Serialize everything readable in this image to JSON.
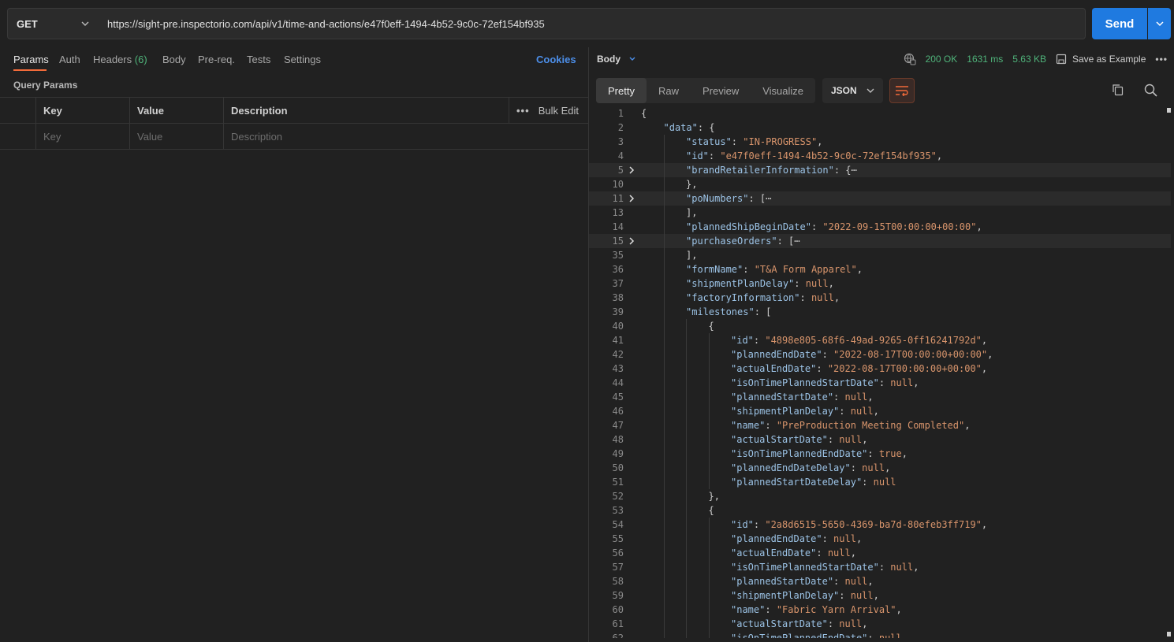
{
  "request": {
    "method": "GET",
    "url": "https://sight-pre.inspectorio.com/api/v1/time-and-actions/e47f0eff-1494-4b52-9c0c-72ef154bf935",
    "send_label": "Send"
  },
  "left_tabs": {
    "params": "Params",
    "auth": "Auth",
    "headers": "Headers",
    "headers_count": "(6)",
    "body": "Body",
    "prereq": "Pre-req.",
    "tests": "Tests",
    "settings": "Settings",
    "cookies": "Cookies"
  },
  "query_params": {
    "title": "Query Params",
    "columns": [
      "Key",
      "Value",
      "Description"
    ],
    "bulk_edit": "Bulk Edit",
    "placeholders": [
      "Key",
      "Value",
      "Description"
    ]
  },
  "response": {
    "section": "Body",
    "status": "200 OK",
    "time": "1631 ms",
    "size": "5.63 KB",
    "save_example": "Save as Example",
    "modes": [
      "Pretty",
      "Raw",
      "Preview",
      "Visualize"
    ],
    "format": "JSON",
    "colors": {
      "accent": "#1f7ae0",
      "ok": "#4fb37a",
      "tab_underline": "#f26b3a",
      "key": "#9cc3e6",
      "string": "#d9956c"
    }
  },
  "code_lines": [
    {
      "n": "1",
      "indent": 0,
      "parts": [
        [
          "p",
          "{"
        ]
      ]
    },
    {
      "n": "2",
      "indent": 1,
      "parts": [
        [
          "k",
          "\"data\""
        ],
        [
          "p",
          ": {"
        ]
      ]
    },
    {
      "n": "3",
      "indent": 2,
      "parts": [
        [
          "k",
          "\"status\""
        ],
        [
          "p",
          ": "
        ],
        [
          "s",
          "\"IN-PROGRESS\""
        ],
        [
          "p",
          ","
        ]
      ]
    },
    {
      "n": "4",
      "indent": 2,
      "parts": [
        [
          "k",
          "\"id\""
        ],
        [
          "p",
          ": "
        ],
        [
          "s",
          "\"e47f0eff-1494-4b52-9c0c-72ef154bf935\""
        ],
        [
          "p",
          ","
        ]
      ]
    },
    {
      "n": "5",
      "indent": 2,
      "fold": true,
      "hl": true,
      "parts": [
        [
          "k",
          "\"brandRetailerInformation\""
        ],
        [
          "p",
          ": {⋯"
        ]
      ]
    },
    {
      "n": "10",
      "indent": 2,
      "parts": [
        [
          "p",
          "},"
        ]
      ]
    },
    {
      "n": "11",
      "indent": 2,
      "fold": true,
      "hl": true,
      "parts": [
        [
          "k",
          "\"poNumbers\""
        ],
        [
          "p",
          ": [⋯"
        ]
      ]
    },
    {
      "n": "13",
      "indent": 2,
      "parts": [
        [
          "p",
          "],"
        ]
      ]
    },
    {
      "n": "14",
      "indent": 2,
      "parts": [
        [
          "k",
          "\"plannedShipBeginDate\""
        ],
        [
          "p",
          ": "
        ],
        [
          "s",
          "\"2022-09-15T00:00:00+00:00\""
        ],
        [
          "p",
          ","
        ]
      ]
    },
    {
      "n": "15",
      "indent": 2,
      "fold": true,
      "hl": true,
      "parts": [
        [
          "k",
          "\"purchaseOrders\""
        ],
        [
          "p",
          ": [⋯"
        ]
      ]
    },
    {
      "n": "35",
      "indent": 2,
      "parts": [
        [
          "p",
          "],"
        ]
      ]
    },
    {
      "n": "36",
      "indent": 2,
      "parts": [
        [
          "k",
          "\"formName\""
        ],
        [
          "p",
          ": "
        ],
        [
          "s",
          "\"T&A Form Apparel\""
        ],
        [
          "p",
          ","
        ]
      ]
    },
    {
      "n": "37",
      "indent": 2,
      "parts": [
        [
          "k",
          "\"shipmentPlanDelay\""
        ],
        [
          "p",
          ": "
        ],
        [
          "n",
          "null"
        ],
        [
          "p",
          ","
        ]
      ]
    },
    {
      "n": "38",
      "indent": 2,
      "parts": [
        [
          "k",
          "\"factoryInformation\""
        ],
        [
          "p",
          ": "
        ],
        [
          "n",
          "null"
        ],
        [
          "p",
          ","
        ]
      ]
    },
    {
      "n": "39",
      "indent": 2,
      "parts": [
        [
          "k",
          "\"milestones\""
        ],
        [
          "p",
          ": ["
        ]
      ]
    },
    {
      "n": "40",
      "indent": 3,
      "parts": [
        [
          "p",
          "{"
        ]
      ]
    },
    {
      "n": "41",
      "indent": 4,
      "parts": [
        [
          "k",
          "\"id\""
        ],
        [
          "p",
          ": "
        ],
        [
          "s",
          "\"4898e805-68f6-49ad-9265-0ff16241792d\""
        ],
        [
          "p",
          ","
        ]
      ]
    },
    {
      "n": "42",
      "indent": 4,
      "parts": [
        [
          "k",
          "\"plannedEndDate\""
        ],
        [
          "p",
          ": "
        ],
        [
          "s",
          "\"2022-08-17T00:00:00+00:00\""
        ],
        [
          "p",
          ","
        ]
      ]
    },
    {
      "n": "43",
      "indent": 4,
      "parts": [
        [
          "k",
          "\"actualEndDate\""
        ],
        [
          "p",
          ": "
        ],
        [
          "s",
          "\"2022-08-17T00:00:00+00:00\""
        ],
        [
          "p",
          ","
        ]
      ]
    },
    {
      "n": "44",
      "indent": 4,
      "parts": [
        [
          "k",
          "\"isOnTimePlannedStartDate\""
        ],
        [
          "p",
          ": "
        ],
        [
          "n",
          "null"
        ],
        [
          "p",
          ","
        ]
      ]
    },
    {
      "n": "45",
      "indent": 4,
      "parts": [
        [
          "k",
          "\"plannedStartDate\""
        ],
        [
          "p",
          ": "
        ],
        [
          "n",
          "null"
        ],
        [
          "p",
          ","
        ]
      ]
    },
    {
      "n": "46",
      "indent": 4,
      "parts": [
        [
          "k",
          "\"shipmentPlanDelay\""
        ],
        [
          "p",
          ": "
        ],
        [
          "n",
          "null"
        ],
        [
          "p",
          ","
        ]
      ]
    },
    {
      "n": "47",
      "indent": 4,
      "parts": [
        [
          "k",
          "\"name\""
        ],
        [
          "p",
          ": "
        ],
        [
          "s",
          "\"PreProduction Meeting Completed\""
        ],
        [
          "p",
          ","
        ]
      ]
    },
    {
      "n": "48",
      "indent": 4,
      "parts": [
        [
          "k",
          "\"actualStartDate\""
        ],
        [
          "p",
          ": "
        ],
        [
          "n",
          "null"
        ],
        [
          "p",
          ","
        ]
      ]
    },
    {
      "n": "49",
      "indent": 4,
      "parts": [
        [
          "k",
          "\"isOnTimePlannedEndDate\""
        ],
        [
          "p",
          ": "
        ],
        [
          "n",
          "true"
        ],
        [
          "p",
          ","
        ]
      ]
    },
    {
      "n": "50",
      "indent": 4,
      "parts": [
        [
          "k",
          "\"plannedEndDateDelay\""
        ],
        [
          "p",
          ": "
        ],
        [
          "n",
          "null"
        ],
        [
          "p",
          ","
        ]
      ]
    },
    {
      "n": "51",
      "indent": 4,
      "parts": [
        [
          "k",
          "\"plannedStartDateDelay\""
        ],
        [
          "p",
          ": "
        ],
        [
          "n",
          "null"
        ]
      ]
    },
    {
      "n": "52",
      "indent": 3,
      "parts": [
        [
          "p",
          "},"
        ]
      ]
    },
    {
      "n": "53",
      "indent": 3,
      "parts": [
        [
          "p",
          "{"
        ]
      ]
    },
    {
      "n": "54",
      "indent": 4,
      "parts": [
        [
          "k",
          "\"id\""
        ],
        [
          "p",
          ": "
        ],
        [
          "s",
          "\"2a8d6515-5650-4369-ba7d-80efeb3ff719\""
        ],
        [
          "p",
          ","
        ]
      ]
    },
    {
      "n": "55",
      "indent": 4,
      "parts": [
        [
          "k",
          "\"plannedEndDate\""
        ],
        [
          "p",
          ": "
        ],
        [
          "n",
          "null"
        ],
        [
          "p",
          ","
        ]
      ]
    },
    {
      "n": "56",
      "indent": 4,
      "parts": [
        [
          "k",
          "\"actualEndDate\""
        ],
        [
          "p",
          ": "
        ],
        [
          "n",
          "null"
        ],
        [
          "p",
          ","
        ]
      ]
    },
    {
      "n": "57",
      "indent": 4,
      "parts": [
        [
          "k",
          "\"isOnTimePlannedStartDate\""
        ],
        [
          "p",
          ": "
        ],
        [
          "n",
          "null"
        ],
        [
          "p",
          ","
        ]
      ]
    },
    {
      "n": "58",
      "indent": 4,
      "parts": [
        [
          "k",
          "\"plannedStartDate\""
        ],
        [
          "p",
          ": "
        ],
        [
          "n",
          "null"
        ],
        [
          "p",
          ","
        ]
      ]
    },
    {
      "n": "59",
      "indent": 4,
      "parts": [
        [
          "k",
          "\"shipmentPlanDelay\""
        ],
        [
          "p",
          ": "
        ],
        [
          "n",
          "null"
        ],
        [
          "p",
          ","
        ]
      ]
    },
    {
      "n": "60",
      "indent": 4,
      "parts": [
        [
          "k",
          "\"name\""
        ],
        [
          "p",
          ": "
        ],
        [
          "s",
          "\"Fabric Yarn Arrival\""
        ],
        [
          "p",
          ","
        ]
      ]
    },
    {
      "n": "61",
      "indent": 4,
      "parts": [
        [
          "k",
          "\"actualStartDate\""
        ],
        [
          "p",
          ": "
        ],
        [
          "n",
          "null"
        ],
        [
          "p",
          ","
        ]
      ]
    },
    {
      "n": "62",
      "indent": 4,
      "parts": [
        [
          "k",
          "\"isOnTimePlannedEndDate\""
        ],
        [
          "p",
          ": "
        ],
        [
          "n",
          "null"
        ]
      ]
    }
  ]
}
